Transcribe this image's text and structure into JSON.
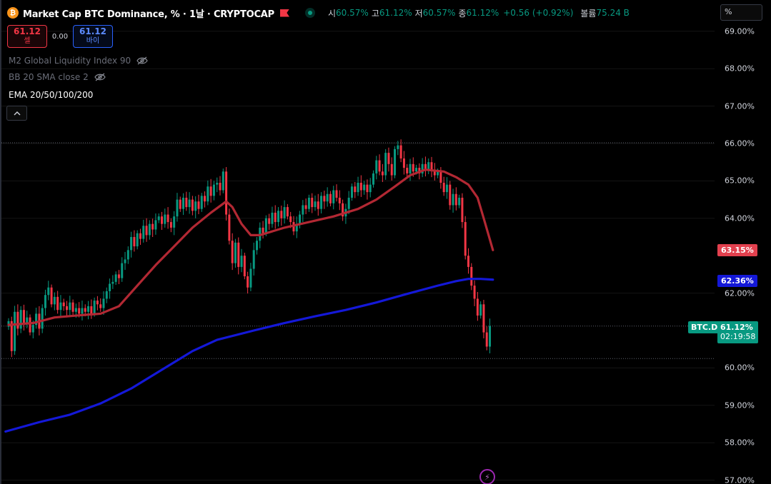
{
  "header": {
    "coin_icon_glyph": "₿",
    "symbol_title": "Market Cap BTC Dominance, % · 1날 · CRYPTOCAP",
    "ohlc": [
      {
        "key": "시",
        "value": "60.57%"
      },
      {
        "key": "고",
        "value": "61.12%"
      },
      {
        "key": "저",
        "value": "60.57%"
      },
      {
        "key": "종",
        "value": "61.12%"
      }
    ],
    "change": "+0.56 (+0.92%)",
    "volume_label": "볼륨",
    "volume_value": "75.24 B"
  },
  "trade": {
    "sell_price": "61.12",
    "sell_label": "셀",
    "spread": "0.00",
    "buy_price": "61.12",
    "buy_label": "바이"
  },
  "indicators": {
    "m2": "M2 Global Liquidity Index 90",
    "bb": "BB 20 SMA close 2",
    "ema": "EMA 20/50/100/200"
  },
  "axis": {
    "search_value": "%",
    "ticks": [
      {
        "value": 69,
        "label": "69.00%"
      },
      {
        "value": 68,
        "label": "68.00%"
      },
      {
        "value": 67,
        "label": "67.00%"
      },
      {
        "value": 66,
        "label": "66.00%"
      },
      {
        "value": 65,
        "label": "65.00%"
      },
      {
        "value": 64,
        "label": "64.00%"
      },
      {
        "value": 62,
        "label": "62.00%"
      },
      {
        "value": 60,
        "label": "60.00%"
      },
      {
        "value": 59,
        "label": "59.00%"
      },
      {
        "value": 58,
        "label": "58.00%"
      },
      {
        "value": 57,
        "label": "57.00%"
      }
    ]
  },
  "badges": {
    "ema_red": "63.15%",
    "ema_blue": "62.36%",
    "symbol": "BTC.D",
    "last_price": "61.12%",
    "countdown": "02:19:58"
  },
  "colors": {
    "up": "#089981",
    "down": "#f23645",
    "ema_short": "#b22833",
    "ema_long": "#1418d8"
  },
  "chart_data": {
    "type": "candlestick",
    "ylim": [
      57,
      69.4
    ],
    "reference_lines": [
      66.02,
      61.12,
      60.25
    ],
    "candles_open_close": [
      [
        61.1,
        61.25
      ],
      [
        61.25,
        60.45
      ],
      [
        60.45,
        61.5
      ],
      [
        61.5,
        61.05
      ],
      [
        61.05,
        61.55
      ],
      [
        61.55,
        61.2
      ],
      [
        61.2,
        61.35
      ],
      [
        61.35,
        60.95
      ],
      [
        60.95,
        61.15
      ],
      [
        61.15,
        61.45
      ],
      [
        61.45,
        61.05
      ],
      [
        61.05,
        61.6
      ],
      [
        61.6,
        61.95
      ],
      [
        61.95,
        62.15
      ],
      [
        62.15,
        61.7
      ],
      [
        61.7,
        61.9
      ],
      [
        61.9,
        61.55
      ],
      [
        61.55,
        61.75
      ],
      [
        61.75,
        61.65
      ],
      [
        61.65,
        61.55
      ],
      [
        61.55,
        61.75
      ],
      [
        61.75,
        61.5
      ],
      [
        61.5,
        61.6
      ],
      [
        61.6,
        61.45
      ],
      [
        61.45,
        61.6
      ],
      [
        61.6,
        61.5
      ],
      [
        61.5,
        61.65
      ],
      [
        61.65,
        61.45
      ],
      [
        61.45,
        61.8
      ],
      [
        61.8,
        61.7
      ],
      [
        61.7,
        61.6
      ],
      [
        61.6,
        61.85
      ],
      [
        61.85,
        62.05
      ],
      [
        62.05,
        62.25
      ],
      [
        62.25,
        62.3
      ],
      [
        62.3,
        62.5
      ],
      [
        62.5,
        62.4
      ],
      [
        62.4,
        62.8
      ],
      [
        62.8,
        62.9
      ],
      [
        62.9,
        63.15
      ],
      [
        63.15,
        63.5
      ],
      [
        63.5,
        63.25
      ],
      [
        63.25,
        63.6
      ],
      [
        63.6,
        63.45
      ],
      [
        63.45,
        63.8
      ],
      [
        63.8,
        63.55
      ],
      [
        63.55,
        63.85
      ],
      [
        63.85,
        63.7
      ],
      [
        63.7,
        63.95
      ],
      [
        63.95,
        64.05
      ],
      [
        64.05,
        63.85
      ],
      [
        63.85,
        64.1
      ],
      [
        64.1,
        63.9
      ],
      [
        63.9,
        63.75
      ],
      [
        63.75,
        64.05
      ],
      [
        64.05,
        64.5
      ],
      [
        64.5,
        64.25
      ],
      [
        64.25,
        64.55
      ],
      [
        64.55,
        64.3
      ],
      [
        64.3,
        64.5
      ],
      [
        64.5,
        64.2
      ],
      [
        64.2,
        64.45
      ],
      [
        64.45,
        64.25
      ],
      [
        64.25,
        64.6
      ],
      [
        64.6,
        64.45
      ],
      [
        64.45,
        64.85
      ],
      [
        64.85,
        64.6
      ],
      [
        64.6,
        64.9
      ],
      [
        64.9,
        64.95
      ],
      [
        64.95,
        64.75
      ],
      [
        64.75,
        65.25
      ],
      [
        65.25,
        64.1
      ],
      [
        64.1,
        63.4
      ],
      [
        63.4,
        62.8
      ],
      [
        62.8,
        63.35
      ],
      [
        63.35,
        62.7
      ],
      [
        62.7,
        63.0
      ],
      [
        63.0,
        62.45
      ],
      [
        62.45,
        62.15
      ],
      [
        62.15,
        62.65
      ],
      [
        62.65,
        63.15
      ],
      [
        63.15,
        63.4
      ],
      [
        63.4,
        63.75
      ],
      [
        63.75,
        63.6
      ],
      [
        63.6,
        64.0
      ],
      [
        64.0,
        63.85
      ],
      [
        63.85,
        64.15
      ],
      [
        64.15,
        63.9
      ],
      [
        63.9,
        64.2
      ],
      [
        64.2,
        64.0
      ],
      [
        64.0,
        64.3
      ],
      [
        64.3,
        64.05
      ],
      [
        64.05,
        63.9
      ],
      [
        63.9,
        63.65
      ],
      [
        63.65,
        63.85
      ],
      [
        63.85,
        64.1
      ],
      [
        64.1,
        64.35
      ],
      [
        64.35,
        64.25
      ],
      [
        64.25,
        64.55
      ],
      [
        64.55,
        64.3
      ],
      [
        64.3,
        64.45
      ],
      [
        64.45,
        64.25
      ],
      [
        64.25,
        64.6
      ],
      [
        64.6,
        64.45
      ],
      [
        64.45,
        64.65
      ],
      [
        64.65,
        64.4
      ],
      [
        64.4,
        64.75
      ],
      [
        64.75,
        64.55
      ],
      [
        64.55,
        64.4
      ],
      [
        64.4,
        64.05
      ],
      [
        64.05,
        64.25
      ],
      [
        64.25,
        64.55
      ],
      [
        64.55,
        64.85
      ],
      [
        64.85,
        64.7
      ],
      [
        64.7,
        64.95
      ],
      [
        64.95,
        64.75
      ],
      [
        64.75,
        64.9
      ],
      [
        64.9,
        64.7
      ],
      [
        64.7,
        64.9
      ],
      [
        64.9,
        65.2
      ],
      [
        65.2,
        65.55
      ],
      [
        65.55,
        65.25
      ],
      [
        65.25,
        65.15
      ],
      [
        65.15,
        65.75
      ],
      [
        65.75,
        65.45
      ],
      [
        65.45,
        65.15
      ],
      [
        65.15,
        65.85
      ],
      [
        65.85,
        65.95
      ],
      [
        65.95,
        65.6
      ],
      [
        65.6,
        65.35
      ],
      [
        65.35,
        65.2
      ],
      [
        65.2,
        65.45
      ],
      [
        65.45,
        65.25
      ],
      [
        65.25,
        65.35
      ],
      [
        65.35,
        65.2
      ],
      [
        65.2,
        65.45
      ],
      [
        65.45,
        65.3
      ],
      [
        65.3,
        65.5
      ],
      [
        65.5,
        65.3
      ],
      [
        65.3,
        65.15
      ],
      [
        65.15,
        65.25
      ],
      [
        65.25,
        64.95
      ],
      [
        64.95,
        64.7
      ],
      [
        64.7,
        64.9
      ],
      [
        64.9,
        64.35
      ],
      [
        64.35,
        64.65
      ],
      [
        64.65,
        64.35
      ],
      [
        64.35,
        64.55
      ],
      [
        64.55,
        63.9
      ],
      [
        63.9,
        63.0
      ],
      [
        63.0,
        62.7
      ],
      [
        62.7,
        62.2
      ],
      [
        62.2,
        61.85
      ],
      [
        61.85,
        61.4
      ],
      [
        61.4,
        61.7
      ],
      [
        61.7,
        60.95
      ],
      [
        60.95,
        60.57
      ],
      [
        60.57,
        61.12
      ]
    ],
    "ema_short": [
      [
        0,
        61.15
      ],
      [
        8,
        61.2
      ],
      [
        15,
        61.35
      ],
      [
        22,
        61.4
      ],
      [
        30,
        61.45
      ],
      [
        36,
        61.65
      ],
      [
        42,
        62.2
      ],
      [
        48,
        62.75
      ],
      [
        54,
        63.25
      ],
      [
        60,
        63.75
      ],
      [
        66,
        64.15
      ],
      [
        71,
        64.45
      ],
      [
        73,
        64.3
      ],
      [
        76,
        63.85
      ],
      [
        79,
        63.55
      ],
      [
        82,
        63.55
      ],
      [
        90,
        63.75
      ],
      [
        98,
        63.9
      ],
      [
        106,
        64.05
      ],
      [
        114,
        64.25
      ],
      [
        120,
        64.5
      ],
      [
        126,
        64.85
      ],
      [
        131,
        65.15
      ],
      [
        136,
        65.3
      ],
      [
        142,
        65.25
      ],
      [
        146,
        65.1
      ],
      [
        150,
        64.9
      ],
      [
        153,
        64.55
      ],
      [
        155,
        64.0
      ],
      [
        158,
        63.15
      ]
    ],
    "ema_long": [
      [
        -1,
        58.3
      ],
      [
        10,
        58.55
      ],
      [
        20,
        58.75
      ],
      [
        30,
        59.05
      ],
      [
        40,
        59.45
      ],
      [
        50,
        59.95
      ],
      [
        60,
        60.45
      ],
      [
        68,
        60.75
      ],
      [
        80,
        61.0
      ],
      [
        90,
        61.2
      ],
      [
        100,
        61.38
      ],
      [
        110,
        61.55
      ],
      [
        120,
        61.75
      ],
      [
        130,
        61.98
      ],
      [
        140,
        62.2
      ],
      [
        146,
        62.32
      ],
      [
        150,
        62.38
      ],
      [
        154,
        62.38
      ],
      [
        158,
        62.36
      ]
    ]
  }
}
